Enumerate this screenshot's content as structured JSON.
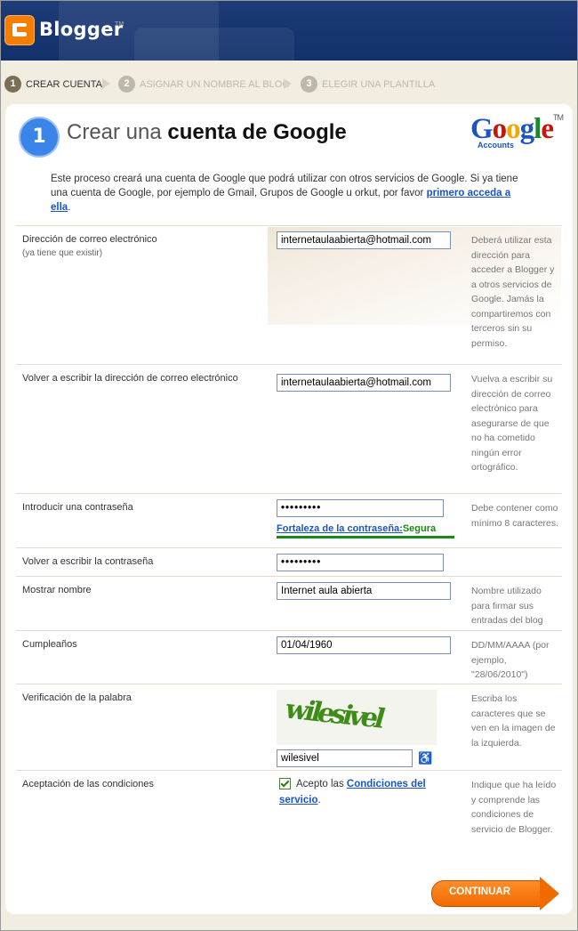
{
  "header": {
    "app_name": "Blogger",
    "tm": "TM"
  },
  "steps": [
    {
      "num": "1",
      "label": "CREAR CUENTA"
    },
    {
      "num": "2",
      "label": "ASIGNAR UN NOMBRE AL BLOG"
    },
    {
      "num": "3",
      "label": "ELEGIR UNA PLANTILLA"
    }
  ],
  "title": {
    "num": "1",
    "prefix": "Crear una ",
    "bold": "cuenta de Google"
  },
  "google_logo": {
    "text": [
      "G",
      "o",
      "o",
      "g",
      "l",
      "e"
    ],
    "tm": "TM",
    "sub": "Accounts"
  },
  "intro": {
    "text": "Este proceso creará una cuenta de Google que podrá utilizar con otros servicios de Google. Si ya tiene una cuenta de Google, por ejemplo de Gmail, Grupos de Google u orkut, por favor ",
    "link": "primero acceda a ella",
    "end": "."
  },
  "form": {
    "email": {
      "label": "Dirección de correo electrónico",
      "sublabel": "(ya tiene que existir)",
      "value": "internetaulaabierta@hotmail.com",
      "help": "Deberá utilizar esta dirección para acceder a Blogger y a otros servicios de Google. Jamás la compartiremos con terceros sin su permiso."
    },
    "email_confirm": {
      "label": "Volver a escribir la dirección de correo electrónico",
      "value": "internetaulaabierta@hotmail.com",
      "help": "Vuelva a escribir su dirección de correo electrónico para asegurarse de que no ha cometido ningún error ortográfico."
    },
    "password": {
      "label": "Introducir una contraseña",
      "value": "•••••••••",
      "strength_label": "Fortaleza de la contraseña:",
      "strength_value": "Segura",
      "help": "Debe contener como mínimo 8 caracteres."
    },
    "password_confirm": {
      "label": "Volver a escribir la contraseña",
      "value": "•••••••••"
    },
    "display_name": {
      "label": "Mostrar nombre",
      "value": "Internet aula abierta",
      "help": "Nombre utilizado para firmar sus entradas del blog"
    },
    "birthday": {
      "label": "Cumpleaños",
      "value": "01/04/1960",
      "help": "DD/MM/AAAA (por ejemplo, \"28/06/2010\")"
    },
    "captcha": {
      "label": "Verificación de la palabra",
      "image_text": "wilesivel",
      "value": "wilesivel",
      "help": "Escriba los caracteres que se ven en la imagen de la izquierda."
    },
    "terms": {
      "label": "Aceptación de las condiciones",
      "checked": true,
      "text": "Acepto las ",
      "link": "Condiciones del servicio",
      "end": ".",
      "help": "Indique que ha leído y comprende las condiciones de servicio de Blogger."
    }
  },
  "continue_label": "CONTINUAR",
  "colors": {
    "header": "#1d3c78",
    "accent": "#f57d00",
    "link": "#1a55c4",
    "strong": "#178a17"
  }
}
